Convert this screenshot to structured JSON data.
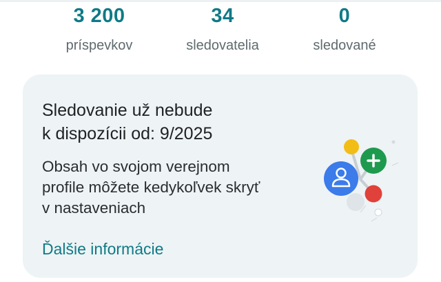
{
  "stats": [
    {
      "value": "3 200",
      "label": "príspevkov"
    },
    {
      "value": "34",
      "label": "sledovatelia"
    },
    {
      "value": "0",
      "label": "sledované"
    }
  ],
  "card": {
    "title_lines": [
      "Sledovanie už nebude",
      "k dispozícii od: 9/2025"
    ],
    "body_lines": [
      "Obsah vo svojom verejnom",
      "profile môžete kedykoľvek skryť",
      "v nastaveniach"
    ],
    "link_label": "Ďalšie informácie"
  },
  "illustration": {
    "icons": [
      "person-icon",
      "plus-icon"
    ],
    "colors": {
      "blue": "#3b7bea",
      "green": "#1e9a4f",
      "yellow": "#f2bd17",
      "red": "#e0413a"
    }
  },
  "colors": {
    "accent": "#0f7a86",
    "card_background": "#eef3f5"
  }
}
